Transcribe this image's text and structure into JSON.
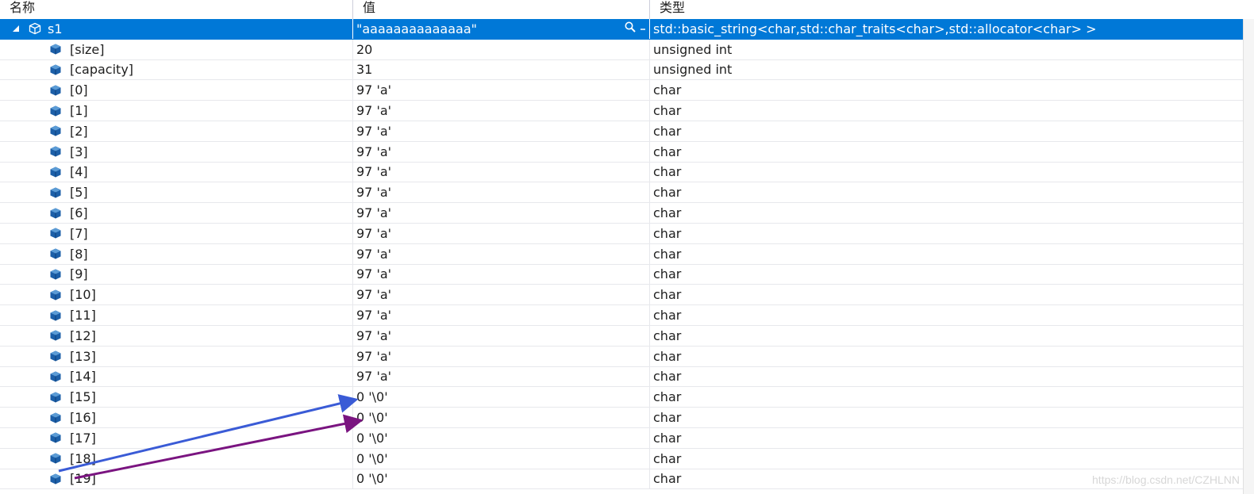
{
  "columns": {
    "name": "名称",
    "value": "值",
    "type": "类型"
  },
  "root": {
    "name": "s1",
    "value": "\"aaaaaaaaaaaaaa\"",
    "type": "std::basic_string<char,std::char_traits<char>,std::allocator<char> >"
  },
  "rows": [
    {
      "name": "[size]",
      "value": "20",
      "type": "unsigned int"
    },
    {
      "name": "[capacity]",
      "value": "31",
      "type": "unsigned int"
    },
    {
      "name": "[0]",
      "value": "97 'a'",
      "type": "char"
    },
    {
      "name": "[1]",
      "value": "97 'a'",
      "type": "char"
    },
    {
      "name": "[2]",
      "value": "97 'a'",
      "type": "char"
    },
    {
      "name": "[3]",
      "value": "97 'a'",
      "type": "char"
    },
    {
      "name": "[4]",
      "value": "97 'a'",
      "type": "char"
    },
    {
      "name": "[5]",
      "value": "97 'a'",
      "type": "char"
    },
    {
      "name": "[6]",
      "value": "97 'a'",
      "type": "char"
    },
    {
      "name": "[7]",
      "value": "97 'a'",
      "type": "char"
    },
    {
      "name": "[8]",
      "value": "97 'a'",
      "type": "char"
    },
    {
      "name": "[9]",
      "value": "97 'a'",
      "type": "char"
    },
    {
      "name": "[10]",
      "value": "97 'a'",
      "type": "char"
    },
    {
      "name": "[11]",
      "value": "97 'a'",
      "type": "char"
    },
    {
      "name": "[12]",
      "value": "97 'a'",
      "type": "char"
    },
    {
      "name": "[13]",
      "value": "97 'a'",
      "type": "char"
    },
    {
      "name": "[14]",
      "value": "97 'a'",
      "type": "char"
    },
    {
      "name": "[15]",
      "value": "0 '\\0'",
      "type": "char"
    },
    {
      "name": "[16]",
      "value": "0 '\\0'",
      "type": "char"
    },
    {
      "name": "[17]",
      "value": "0 '\\0'",
      "type": "char"
    },
    {
      "name": "[18]",
      "value": "0 '\\0'",
      "type": "char"
    },
    {
      "name": "[19]",
      "value": "0 '\\0'",
      "type": "char"
    }
  ],
  "colors": {
    "selection": "#0078d7",
    "object_icon": "#1c5fa8",
    "annotation_blue": "#3a5bd6",
    "annotation_purple": "#7a1480"
  },
  "icons": {
    "expander": "triangle-expanded-icon",
    "object": "object-cube-icon",
    "field": "field-cube-icon",
    "magnifier": "magnifier-icon",
    "dropdown": "dropdown-arrow-icon"
  },
  "watermark": "https://blog.csdn.net/CZHLNN"
}
